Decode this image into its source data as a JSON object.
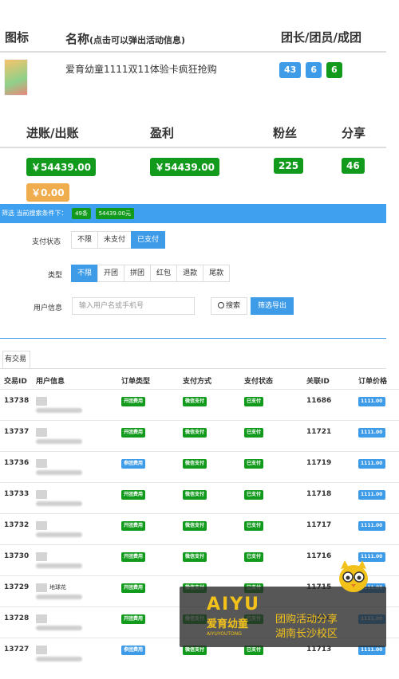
{
  "header": {
    "col_icon": "图标",
    "col_name": "名称",
    "col_name_hint": "(点击可以弹出活动信息)",
    "col_stats": "团长/团员/成团",
    "activity_name": "爱育幼童1111双11体验卡疯狂抢购",
    "leaders": "43",
    "members": "6",
    "groups": "6"
  },
  "summary": {
    "col_income": "进账/出账",
    "col_profit": "盈利",
    "col_fans": "粉丝",
    "col_share": "分享",
    "income": "￥54439.00",
    "profit": "￥54439.00",
    "fans": "225",
    "share": "46",
    "outgo": "￥0.00"
  },
  "filterbar": {
    "text": "筛选 当前搜索条件下：",
    "count": "49条",
    "amount": "54439.00元"
  },
  "filters": {
    "pay_status_label": "支付状态",
    "pay_status_options": [
      "不限",
      "未支付",
      "已支付"
    ],
    "type_label": "类型",
    "type_options": [
      "不限",
      "开团",
      "拼团",
      "红包",
      "退款",
      "尾款"
    ],
    "user_label": "用户信息",
    "user_placeholder": "输入用户名或手机号",
    "search_label": "搜索",
    "export_label": "筛选导出"
  },
  "tab": {
    "label": "有交易"
  },
  "table": {
    "headers": [
      "交易ID",
      "用户信息",
      "订单类型",
      "支付方式",
      "支付状态",
      "关联ID",
      "订单价格"
    ],
    "rows": [
      {
        "id": "13738",
        "user": "",
        "type": "开团费用",
        "type_color": "#119a1c",
        "method": "微信支付",
        "status": "已支付",
        "rel": "11686",
        "price": "1111.00"
      },
      {
        "id": "13737",
        "user": "",
        "type": "开团费用",
        "type_color": "#119a1c",
        "method": "微信支付",
        "status": "已支付",
        "rel": "11721",
        "price": "1111.00"
      },
      {
        "id": "13736",
        "user": "",
        "type": "参团费用",
        "type_color": "#3e9be8",
        "method": "微信支付",
        "status": "已支付",
        "rel": "11719",
        "price": "1111.00"
      },
      {
        "id": "13733",
        "user": "",
        "type": "开团费用",
        "type_color": "#119a1c",
        "method": "微信支付",
        "status": "已支付",
        "rel": "11718",
        "price": "1111.00"
      },
      {
        "id": "13732",
        "user": "",
        "type": "开团费用",
        "type_color": "#119a1c",
        "method": "微信支付",
        "status": "已支付",
        "rel": "11717",
        "price": "1111.00"
      },
      {
        "id": "13730",
        "user": "",
        "type": "开团费用",
        "type_color": "#119a1c",
        "method": "微信支付",
        "status": "已支付",
        "rel": "11716",
        "price": "1111.00"
      },
      {
        "id": "13729",
        "user": "地球花",
        "type": "开团费用",
        "type_color": "#119a1c",
        "method": "微信支付",
        "status": "已支付",
        "rel": "11715",
        "price": "1111.00"
      },
      {
        "id": "13728",
        "user": "",
        "type": "开团费用",
        "type_color": "#119a1c",
        "method": "微信支付",
        "status": "已支付",
        "rel": "11714",
        "price": "1111.00"
      },
      {
        "id": "13727",
        "user": "",
        "type": "参团费用",
        "type_color": "#3e9be8",
        "method": "微信支付",
        "status": "已支付",
        "rel": "11713",
        "price": "1111.00"
      }
    ]
  },
  "watermark": {
    "brand": "AIYU",
    "brand_cn": "爱育幼童",
    "brand_sub": "AIYUYOUTONG",
    "line1": "团购活动分享",
    "line2": "湖南长沙校区"
  },
  "colors": {
    "blue": "#3e9be8",
    "green": "#119a1c",
    "orange": "#f0ad4e",
    "bar": "#3fa0f0"
  }
}
